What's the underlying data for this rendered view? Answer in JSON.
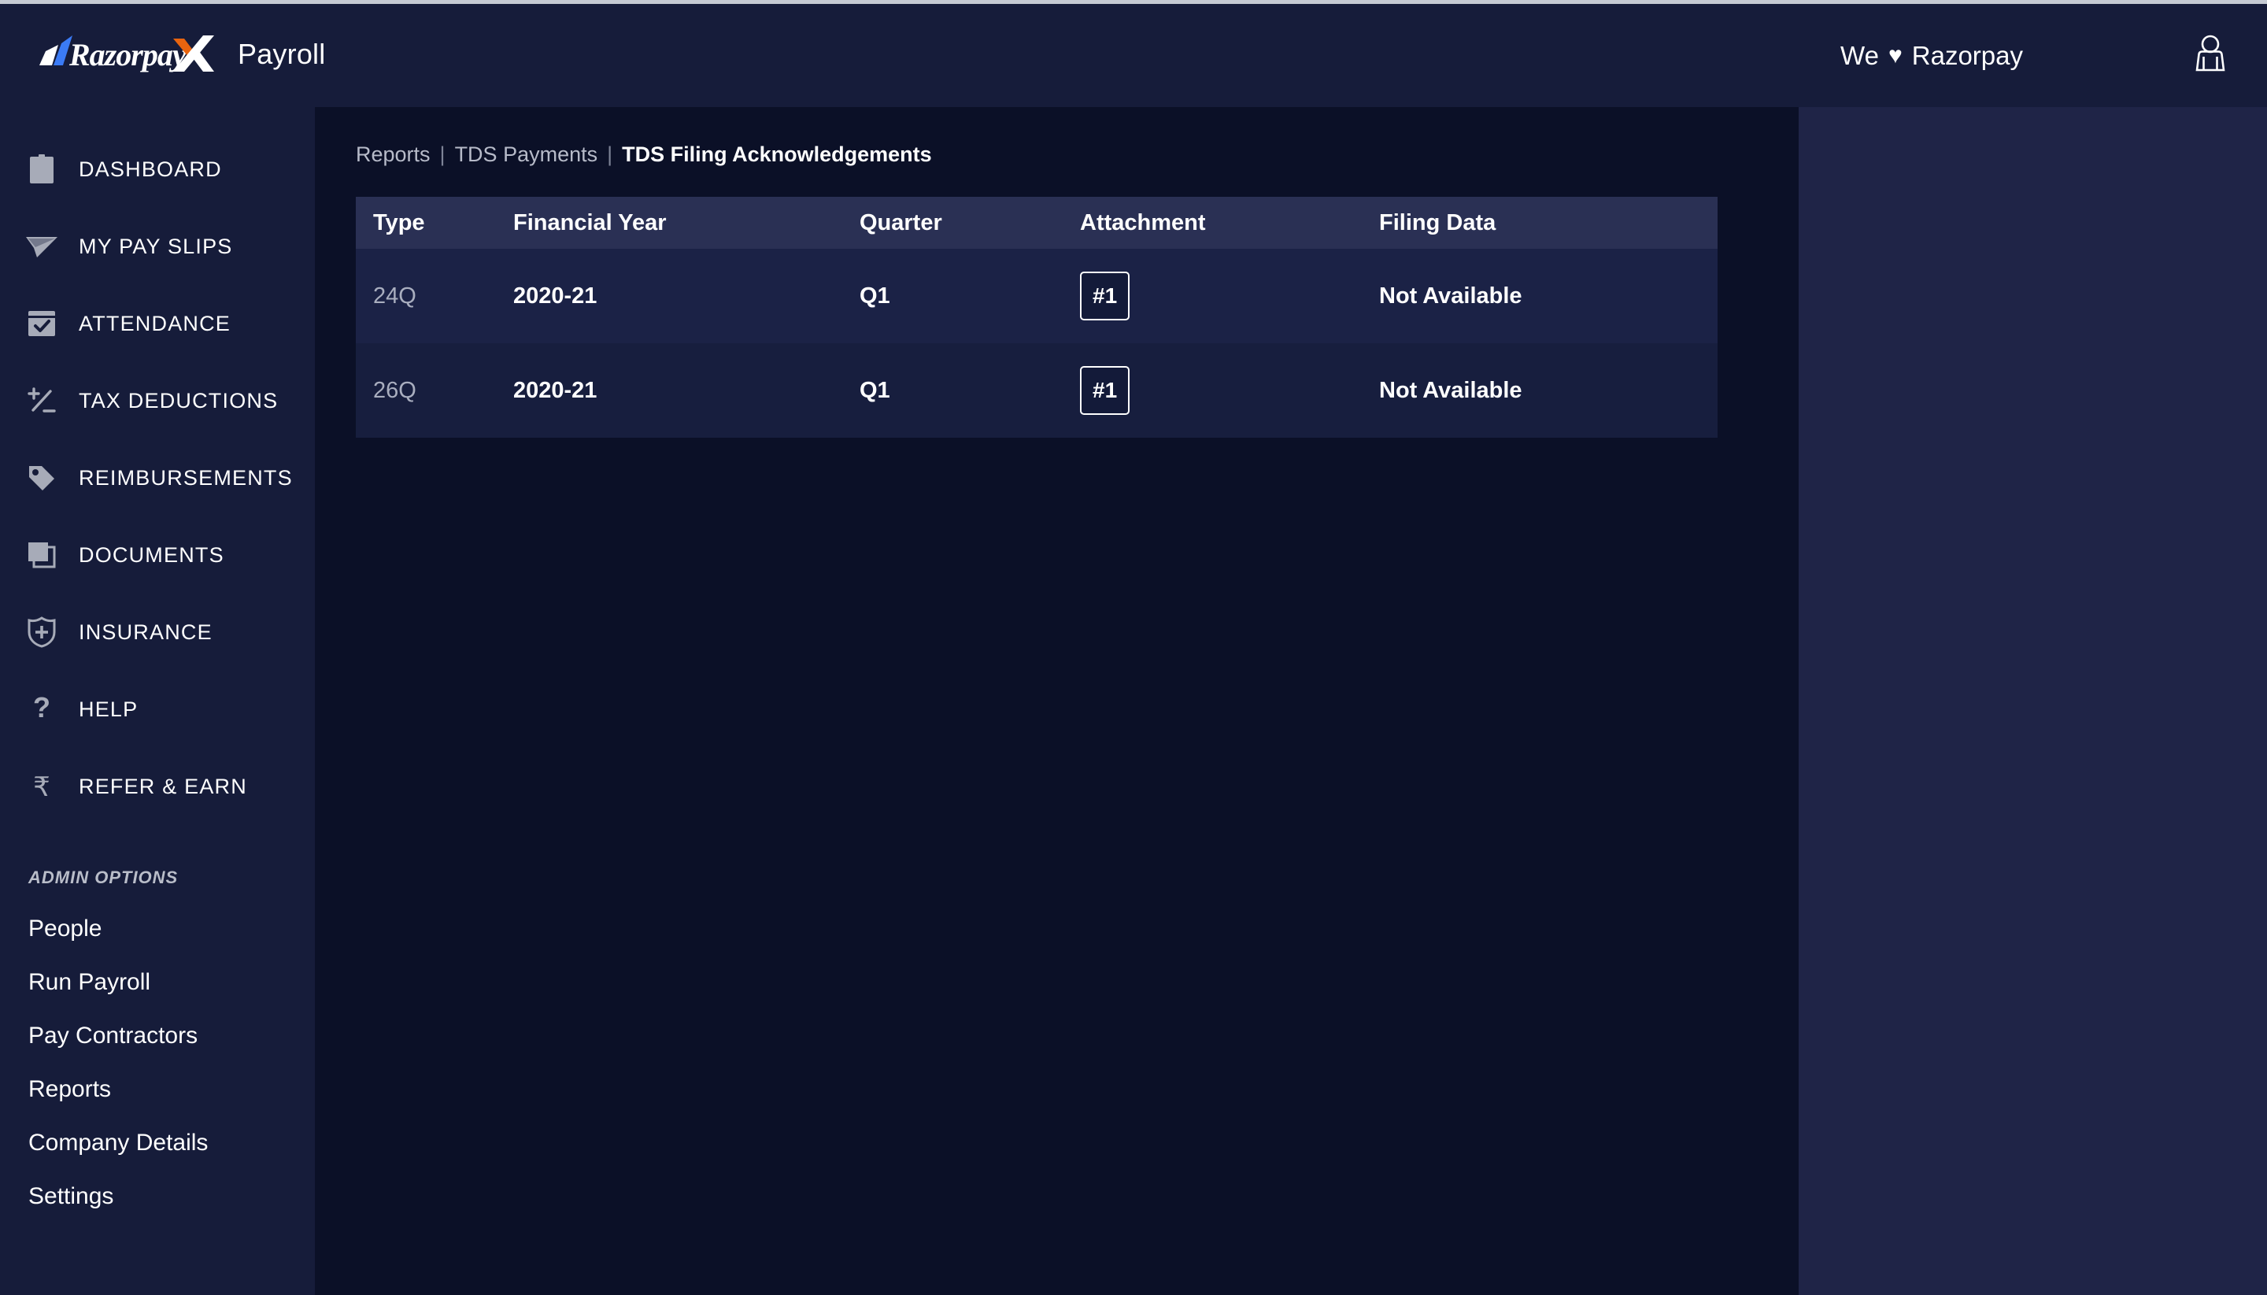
{
  "header": {
    "brand_name": "Payroll",
    "logo_text": "RazorpayX",
    "tagline": "We",
    "heart_icon": "heart-icon",
    "tagline_suffix": "Razorpay",
    "avatar_icon": "user-avatar-icon",
    "background": "#161c3a",
    "logo_blue": "#3b7bf5",
    "logo_orange": "#e8640f"
  },
  "sidebar": {
    "background": "#161c3a",
    "items": [
      {
        "label": "DASHBOARD",
        "icon": "clipboard-icon"
      },
      {
        "label": "MY PAY SLIPS",
        "icon": "paper-plane-icon"
      },
      {
        "label": "ATTENDANCE",
        "icon": "calendar-check-icon"
      },
      {
        "label": "TAX DEDUCTIONS",
        "icon": "plus-minus-icon"
      },
      {
        "label": "REIMBURSEMENTS",
        "icon": "tag-icon"
      },
      {
        "label": "DOCUMENTS",
        "icon": "documents-icon"
      },
      {
        "label": "INSURANCE",
        "icon": "shield-plus-icon"
      },
      {
        "label": "HELP",
        "icon": "question-mark-icon"
      },
      {
        "label": "REFER & EARN",
        "icon": "rupee-icon"
      }
    ],
    "admin_heading": "ADMIN OPTIONS",
    "admin_items": [
      {
        "label": "People"
      },
      {
        "label": "Run Payroll"
      },
      {
        "label": "Pay Contractors"
      },
      {
        "label": "Reports"
      },
      {
        "label": "Company Details"
      },
      {
        "label": "Settings"
      }
    ]
  },
  "breadcrumb": {
    "items": [
      {
        "label": "Reports",
        "current": false
      },
      {
        "label": "TDS Payments",
        "current": false
      },
      {
        "label": "TDS Filing Acknowledgements",
        "current": true
      }
    ],
    "separator": "|"
  },
  "table": {
    "columns": [
      "Type",
      "Financial Year",
      "Quarter",
      "Attachment",
      "Filing Data"
    ],
    "rows": [
      {
        "type": "24Q",
        "financial_year": "2020-21",
        "quarter": "Q1",
        "attachment": "#1",
        "filing_data": "Not Available"
      },
      {
        "type": "26Q",
        "financial_year": "2020-21",
        "quarter": "Q1",
        "attachment": "#1",
        "filing_data": "Not Available"
      }
    ],
    "header_background": "#2a3054",
    "row_background_odd": "#1b2246",
    "row_background_even": "#171e3e"
  },
  "colors": {
    "page_background": "#1f2447",
    "content_background": "#0b1027",
    "accent_blue": "#3b7bf5",
    "accent_orange": "#e8640f"
  }
}
